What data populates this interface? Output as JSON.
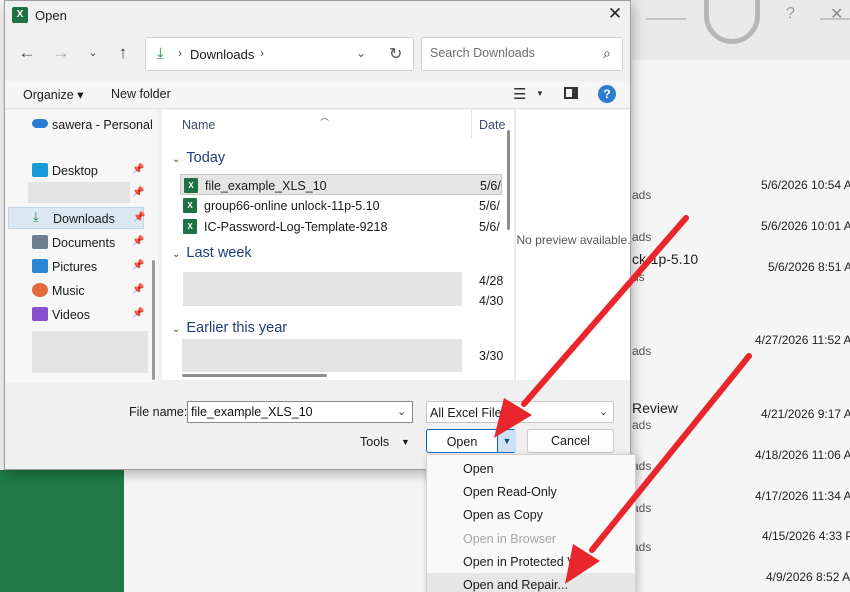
{
  "background": {
    "fragments": [
      {
        "text": "ads",
        "size": "sm"
      },
      {
        "text": "ads",
        "size": "sm"
      },
      {
        "text": "ck-1p-5.10",
        "size": "big"
      },
      {
        "text": "ds",
        "size": "sm"
      },
      {
        "text": "ads",
        "size": "sm"
      },
      {
        "text": "Review",
        "size": "big"
      },
      {
        "text": "ads",
        "size": "sm"
      },
      {
        "text": "ads",
        "size": "sm"
      },
      {
        "text": "ads",
        "size": "sm"
      },
      {
        "text": "ads",
        "size": "sm"
      }
    ],
    "dates": [
      "5/6/2026 10:54 A",
      "5/6/2026 10:01 A",
      "5/6/2026 8:51 A",
      "4/27/2026 11:52 A",
      "4/21/2026 9:17 A",
      "4/18/2026 11:06 A",
      "4/17/2026 11:34 A",
      "4/15/2026 4:33 P",
      "4/9/2026 8:52 A"
    ]
  },
  "dialog": {
    "title": "Open",
    "app_icon": "X",
    "close_glyph": "✕",
    "address": {
      "segment": "Downloads",
      "separator": "›"
    },
    "search_placeholder": "Search Downloads",
    "toolbar": {
      "organize": "Organize ▾",
      "new_folder": "New folder",
      "help": "?"
    },
    "nav": {
      "onedrive": "sawera - Personal",
      "items": [
        {
          "label": "Desktop",
          "icon": "desktop-icon",
          "color": "#1a9ad6"
        },
        {
          "label": "Downloads",
          "icon": "downloads-icon",
          "color": "#1d8c3a",
          "selected": true
        },
        {
          "label": "Documents",
          "icon": "documents-icon",
          "color": "#6b7d8f"
        },
        {
          "label": "Pictures",
          "icon": "pictures-icon",
          "color": "#2a86d4"
        },
        {
          "label": "Music",
          "icon": "music-icon",
          "color": "#e26a3a"
        },
        {
          "label": "Videos",
          "icon": "videos-icon",
          "color": "#8a4fcf"
        }
      ]
    },
    "columns": {
      "name": "Name",
      "date": "Date"
    },
    "groups": {
      "today": "Today",
      "last_week": "Last week",
      "earlier": "Earlier this year"
    },
    "files_today": [
      {
        "name": "file_example_XLS_10",
        "date": "5/6/",
        "selected": true
      },
      {
        "name": "group66-online unlock-11p-5.10",
        "date": "5/6/"
      },
      {
        "name": "IC-Password-Log-Template-9218",
        "date": "5/6/"
      }
    ],
    "dates_last_week": [
      "4/28",
      "4/30"
    ],
    "dates_earlier": [
      "3/30"
    ],
    "preview_text": "No preview available.",
    "file_name_label": "File name:",
    "file_name_value": "file_example_XLS_10",
    "file_type": "All Excel Files",
    "tools": "Tools",
    "open_button": "Open",
    "cancel_button": "Cancel",
    "open_menu": [
      {
        "label": "Open",
        "enabled": true
      },
      {
        "label": "Open Read-Only",
        "enabled": true
      },
      {
        "label": "Open as Copy",
        "enabled": true
      },
      {
        "label": "Open in Browser",
        "enabled": false
      },
      {
        "label": "Open in Protected View",
        "enabled": true
      },
      {
        "label": "Open and Repair...",
        "enabled": true,
        "highlighted": true
      }
    ]
  },
  "colors": {
    "accent": "#0067c0",
    "excel_green": "#1e7145",
    "arrow_red": "#e8262b"
  }
}
